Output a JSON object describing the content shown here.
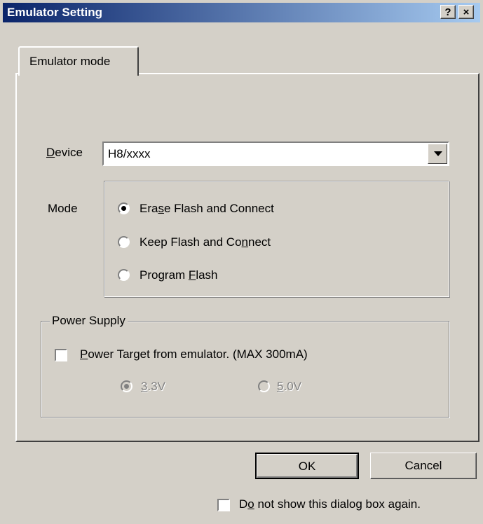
{
  "window": {
    "title": "Emulator Setting",
    "help_glyph": "?",
    "close_glyph": "×"
  },
  "tabs": [
    {
      "label": "Emulator mode",
      "selected": true
    }
  ],
  "device": {
    "label_first": "D",
    "label_rest": "evice",
    "value": "H8/xxxx"
  },
  "mode": {
    "label": "Mode",
    "options": [
      {
        "pre": "Era",
        "acc": "s",
        "post": "e Flash and Connect",
        "checked": true
      },
      {
        "pre": "Keep Flash and Co",
        "acc": "n",
        "post": "nect",
        "checked": false
      },
      {
        "pre": "Program ",
        "acc": "F",
        "post": "lash",
        "checked": false
      }
    ]
  },
  "power_supply": {
    "legend": "Power Supply",
    "checkbox_acc": "P",
    "checkbox_rest": "ower Target from emulator. (MAX 300mA)",
    "checkbox_checked": false,
    "voltages": [
      {
        "acc": "3",
        "rest": ".3V",
        "checked": true,
        "enabled": false
      },
      {
        "acc": "5",
        "rest": ".0V",
        "checked": false,
        "enabled": false
      }
    ]
  },
  "buttons": {
    "ok": "OK",
    "cancel": "Cancel"
  },
  "footer": {
    "pre": "D",
    "acc": "o",
    "post": " not show this dialog box again.",
    "checked": false
  }
}
